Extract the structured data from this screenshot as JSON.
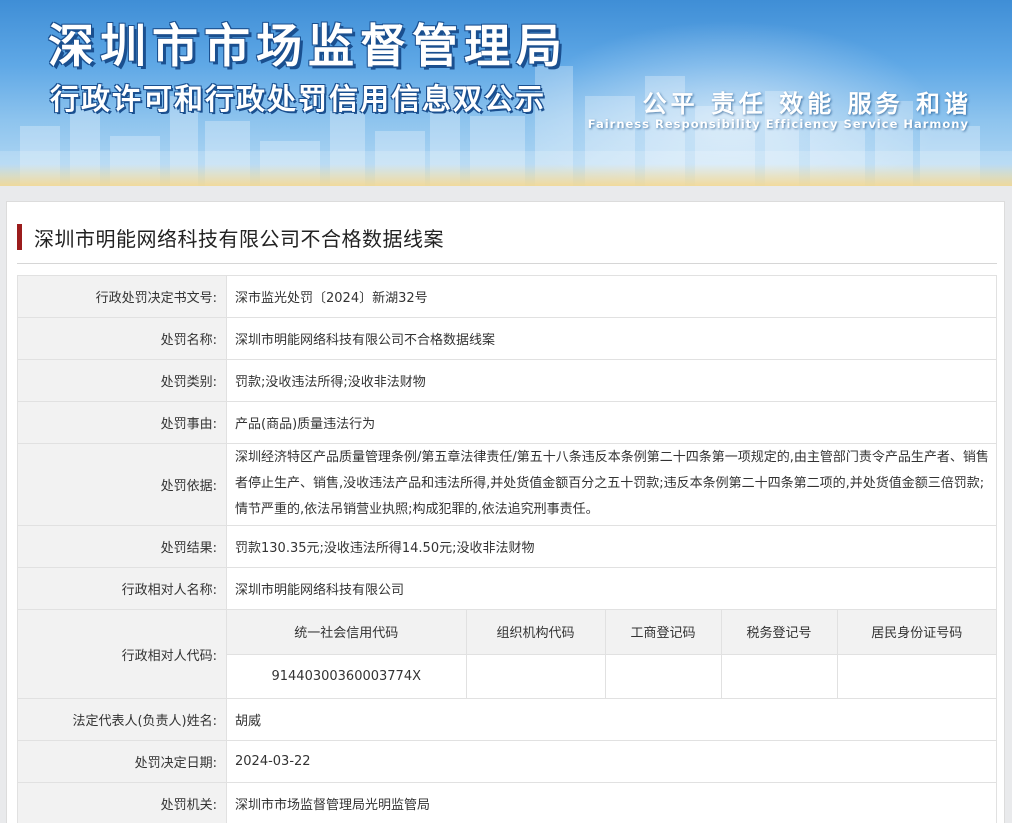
{
  "banner": {
    "title": "深圳市市场监督管理局",
    "subtitle": "行政许可和行政处罚信用信息双公示",
    "slogan_cn": "公平  责任  效能  服务  和谐",
    "slogan_en": "Fairness  Responsibility  Efficiency  Service  Harmony"
  },
  "case": {
    "title": "深圳市明能网络科技有限公司不合格数据线案"
  },
  "rows": [
    {
      "label": "行政处罚决定书文号:",
      "value": "深市监光处罚〔2024〕新湖32号"
    },
    {
      "label": "处罚名称:",
      "value": "深圳市明能网络科技有限公司不合格数据线案"
    },
    {
      "label": "处罚类别:",
      "value": "罚款;没收违法所得;没收非法财物"
    },
    {
      "label": "处罚事由:",
      "value": "产品(商品)质量违法行为"
    },
    {
      "label": "处罚依据:",
      "value": "深圳经济特区产品质量管理条例/第五章法律责任/第五十八条违反本条例第二十四条第一项规定的,由主管部门责令产品生产者、销售者停止生产、销售,没收违法产品和违法所得,并处货值金额百分之五十罚款;违反本条例第二十四条第二项的,并处货值金额三倍罚款;情节严重的,依法吊销营业执照;构成犯罪的,依法追究刑事责任。"
    },
    {
      "label": "处罚结果:",
      "value": "罚款130.35元;没收违法所得14.50元;没收非法财物"
    },
    {
      "label": "行政相对人名称:",
      "value": "深圳市明能网络科技有限公司"
    }
  ],
  "codes": {
    "label": "行政相对人代码:",
    "headers": [
      "统一社会信用代码",
      "组织机构代码",
      "工商登记码",
      "税务登记号",
      "居民身份证号码"
    ],
    "values": [
      "91440300360003774X",
      "",
      "",
      "",
      ""
    ]
  },
  "rows_after": [
    {
      "label": "法定代表人(负责人)姓名:",
      "value": "胡威"
    },
    {
      "label": "处罚决定日期:",
      "value": "2024-03-22"
    },
    {
      "label": "处罚机关:",
      "value": "深圳市市场监督管理局光明监管局"
    }
  ]
}
